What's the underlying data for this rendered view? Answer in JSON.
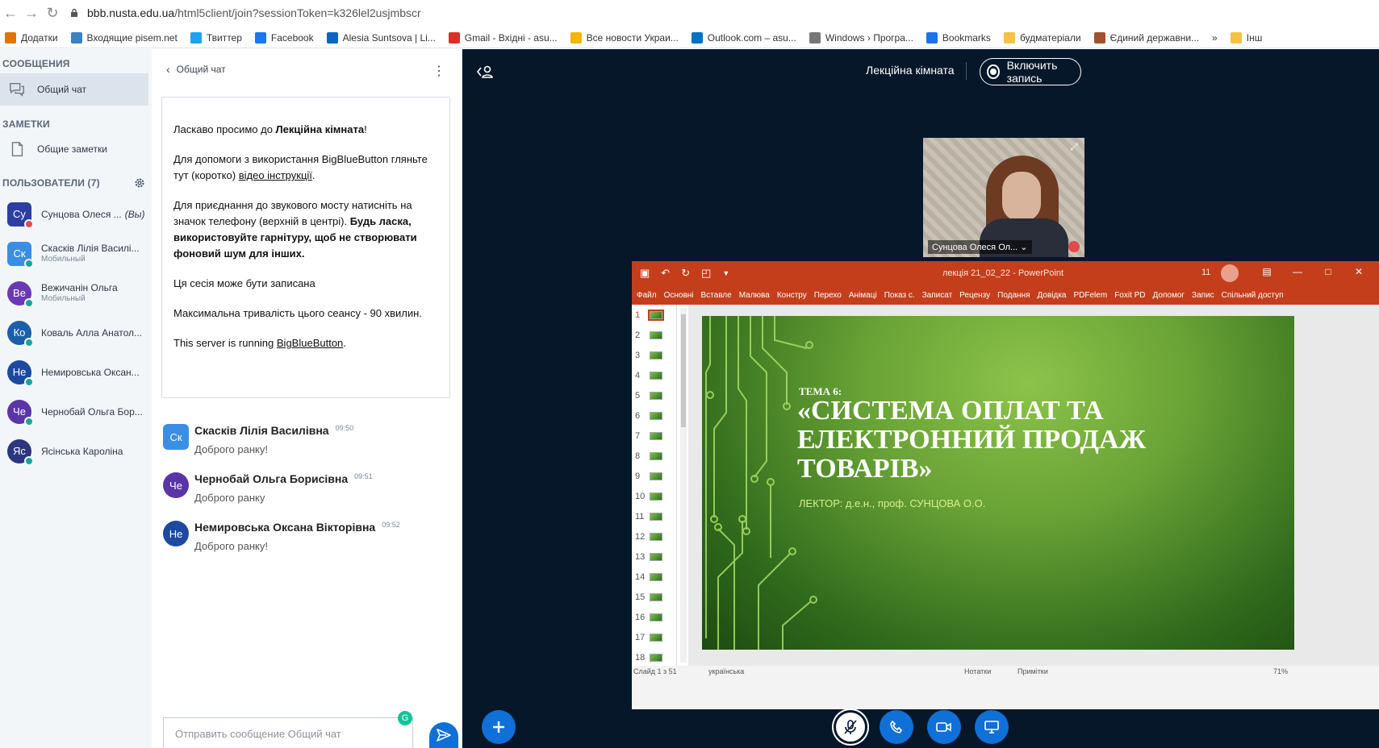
{
  "browser": {
    "url_host": "bbb.nusta.edu.ua",
    "url_path": "/html5client/join?sessionToken=k326lel2usjmbscr"
  },
  "bookmarks": [
    {
      "label": "Додатки",
      "icon": "apps-grid-icon",
      "color": "#e37400"
    },
    {
      "label": "Входящие pisem.net",
      "icon": "mail-icon",
      "color": "#3b82c4"
    },
    {
      "label": "Твиттер",
      "icon": "twitter-icon",
      "color": "#1da1f2"
    },
    {
      "label": "Facebook",
      "icon": "facebook-icon",
      "color": "#1877f2"
    },
    {
      "label": "Alesia Suntsova | Li...",
      "icon": "linkedin-icon",
      "color": "#0a66c2"
    },
    {
      "label": "Gmail - Вхідні - asu...",
      "icon": "gmail-icon",
      "color": "#d93025"
    },
    {
      "label": "Все новости Украи...",
      "icon": "news-icon",
      "color": "#f4b400"
    },
    {
      "label": "Outlook.com – asu...",
      "icon": "outlook-icon",
      "color": "#0072c6"
    },
    {
      "label": "Windows › Програ...",
      "icon": "page-icon",
      "color": "#777777"
    },
    {
      "label": "Bookmarks",
      "icon": "star-icon",
      "color": "#1a73e8"
    },
    {
      "label": "будматеріали",
      "icon": "folder-icon",
      "color": "#f5c242"
    },
    {
      "label": "Єдиний державни...",
      "icon": "gavel-icon",
      "color": "#a0522d"
    },
    {
      "label": "»",
      "icon": "more-icon",
      "color": "#333333"
    },
    {
      "label": "Інш",
      "icon": "folder-icon",
      "color": "#f5c242"
    }
  ],
  "sidebar": {
    "messages_title": "СООБЩЕНИЯ",
    "public_chat": "Общий чат",
    "notes_title": "ЗАМЕТКИ",
    "shared_notes": "Общие заметки",
    "users_title": "ПОЛЬЗОВАТЕЛИ (7)",
    "users": [
      {
        "initials": "Су",
        "name": "Сунцова Олеся ...",
        "suffix": "(Вы)",
        "sub": "",
        "color": "#2c3e9f",
        "shape": "square",
        "badge": "#e24a4a"
      },
      {
        "initials": "Ск",
        "name": "Скасків Лілія Василі...",
        "suffix": "",
        "sub": "Мобильный",
        "color": "#3a8ee6",
        "shape": "square",
        "badge": "#1aa39c"
      },
      {
        "initials": "Ве",
        "name": "Вежичанін Ольга",
        "suffix": "",
        "sub": "Мобильный",
        "color": "#6a3ab5",
        "shape": "round",
        "badge": "#1aa39c"
      },
      {
        "initials": "Ко",
        "name": "Коваль Алла Анатол...",
        "suffix": "",
        "sub": "",
        "color": "#1d5fa8",
        "shape": "round",
        "badge": "#1aa39c"
      },
      {
        "initials": "Не",
        "name": "Немировська Оксан...",
        "suffix": "",
        "sub": "",
        "color": "#1d4aa0",
        "shape": "round",
        "badge": "#1aa39c"
      },
      {
        "initials": "Че",
        "name": "Чернобай Ольга Бор...",
        "suffix": "",
        "sub": "",
        "color": "#5a35a8",
        "shape": "round",
        "badge": "#1aa39c"
      },
      {
        "initials": "Яс",
        "name": "Ясінська Кароліна",
        "suffix": "",
        "sub": "",
        "color": "#2c3580",
        "shape": "round",
        "badge": "#1aa39c"
      }
    ]
  },
  "chat": {
    "title": "Общий чат",
    "welcome_1a": "Ласкаво просимо до ",
    "welcome_1b": "Лекційна кімната",
    "welcome_1c": "!",
    "welcome_2a": "Для допомоги з використання BigBlueButton гляньте тут (коротко) ",
    "welcome_2b": "відео інструкції",
    "welcome_2c": ".",
    "welcome_3a": "Для приєднання до звукового мосту натисніть на значок телефону (верхній в центрі). ",
    "welcome_3b": "Будь ласка, використовуйте гарнітуру, щоб не створювати фоновий шум для інших.",
    "welcome_4": "Ця сесія може бути записана",
    "welcome_5": "Максимальна тривалість цього сеансу - 90 хвилин.",
    "welcome_6a": "This server is running ",
    "welcome_6b": "BigBlueButton",
    "welcome_6c": ".",
    "messages": [
      {
        "initials": "Ск",
        "name": "Скасків Лілія Василівна",
        "time": "09:50",
        "text": "Доброго ранку!",
        "color": "#3a8ee6",
        "shape": "square"
      },
      {
        "initials": "Че",
        "name": "Чернобай Ольга Борисівна",
        "time": "09:51",
        "text": "Доброго ранку",
        "color": "#5a35a8",
        "shape": "round"
      },
      {
        "initials": "Не",
        "name": "Немировська Оксана Вікторівна",
        "time": "09:52",
        "text": "Доброго ранку!",
        "color": "#1d4aa0",
        "shape": "round"
      }
    ],
    "input_placeholder": "Отправить сообщение Общий чат",
    "grammarly": "G"
  },
  "main": {
    "room_name": "Лекційна кімната",
    "record_label": "Включить запись",
    "webcam_label": "Сунцова Олеся Ол..."
  },
  "ppt": {
    "doc_title": "лекція 21_02_22  -  PowerPoint",
    "count": "11",
    "ribbon": [
      "Файл",
      "Основні",
      "Вставле",
      "Малюва",
      "Констру",
      "Перехо",
      "Анімаці",
      "Показ с.",
      "Записат",
      "Рецензу",
      "Подання",
      "Довідка",
      "PDFelem",
      "Foxit PD",
      "Допомог",
      "Запис",
      "Спільний доступ"
    ],
    "thumbs": [
      "1",
      "2",
      "3",
      "4",
      "5",
      "6",
      "7",
      "8",
      "9",
      "10",
      "11",
      "12",
      "13",
      "14",
      "15",
      "16",
      "17",
      "18"
    ],
    "slide_kicker": "ТЕМА 6:",
    "slide_heading": "«СИСТЕМА ОПЛАТ ТА ЕЛЕКТРОННИЙ ПРОДАЖ ТОВАРІВ»",
    "slide_lector": "ЛЕКТОР: д.е.н., проф. СУНЦОВА О.О.",
    "status_slide": "Слайд 1 з 51",
    "status_lang": "українська",
    "status_notes": "Нотатки",
    "status_comments": "Примітки",
    "status_zoom": "71%"
  }
}
